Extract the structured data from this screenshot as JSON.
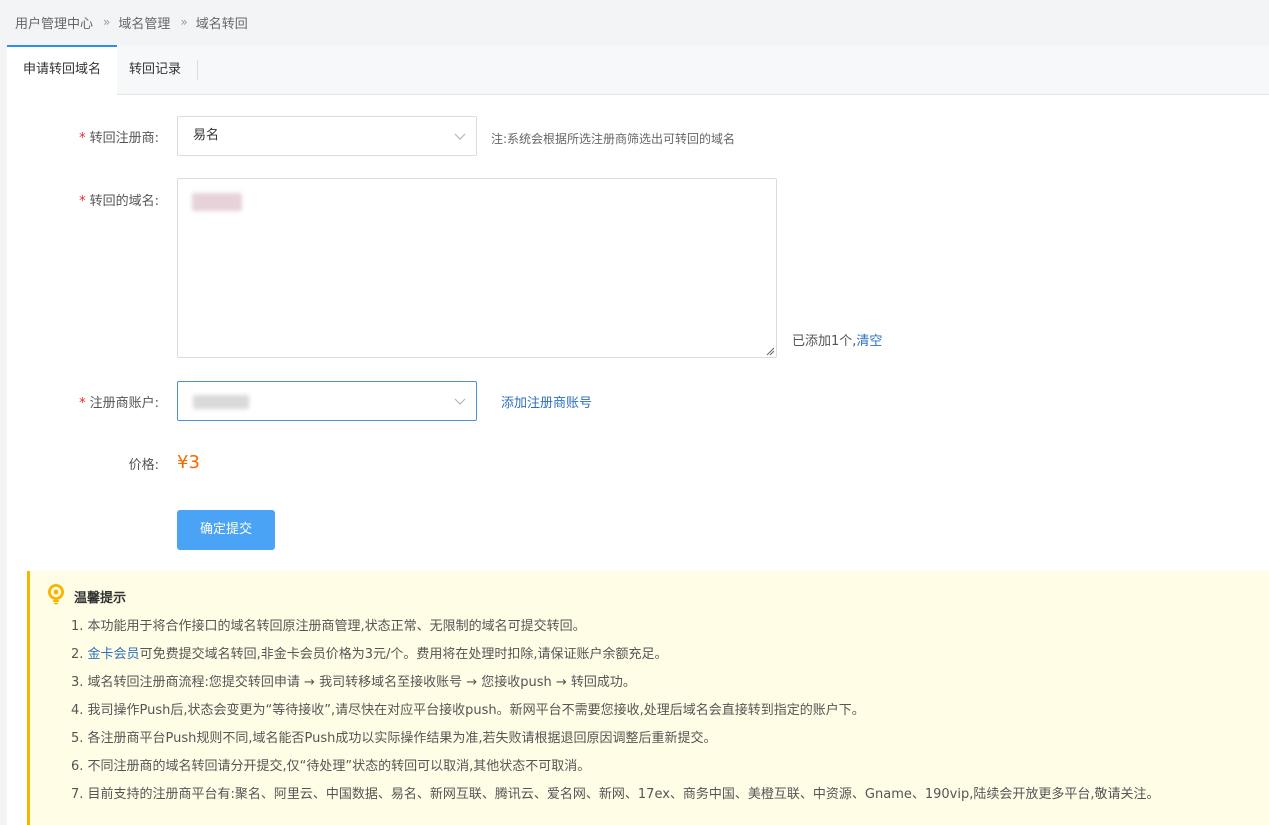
{
  "breadcrumb": [
    "用户管理中心",
    "域名管理",
    "域名转回"
  ],
  "breadcrumb_separator": "»",
  "tabs": [
    {
      "label": "申请转回域名",
      "active": true
    },
    {
      "label": "转回记录",
      "active": false
    }
  ],
  "form": {
    "registrar": {
      "required_mark": "*",
      "label": "转回注册商:",
      "value": "易名",
      "note": "注:系统会根据所选注册商筛选出可转回的域名"
    },
    "domain": {
      "required_mark": "*",
      "label": "转回的域名:",
      "added_text": "已添加1个,",
      "clear_link": "清空"
    },
    "account": {
      "required_mark": "*",
      "label": "注册商账户:",
      "add_link": "添加注册商账号"
    },
    "price": {
      "label": "价格:",
      "value": "¥3"
    },
    "submit_label": "确定提交"
  },
  "tips": {
    "title": "温馨提示",
    "items": [
      {
        "prefix": "1. 本功能用于将合作接口的域名转回原注册商管理,状态正常、无限制的域名可提交转回。",
        "link": "",
        "suffix": ""
      },
      {
        "prefix": "2. ",
        "link": "金卡会员",
        "suffix": "可免费提交域名转回,非金卡会员价格为3元/个。费用将在处理时扣除,请保证账户余额充足。"
      },
      {
        "prefix": "3. 域名转回注册商流程:您提交转回申请 → 我司转移域名至接收账号 → 您接收push → 转回成功。",
        "link": "",
        "suffix": ""
      },
      {
        "prefix": "4. 我司操作Push后,状态会变更为“等待接收”,请尽快在对应平台接收push。新网平台不需要您接收,处理后域名会直接转到指定的账户下。",
        "link": "",
        "suffix": ""
      },
      {
        "prefix": "5. 各注册商平台Push规则不同,域名能否Push成功以实际操作结果为准,若失败请根据退回原因调整后重新提交。",
        "link": "",
        "suffix": ""
      },
      {
        "prefix": "6. 不同注册商的域名转回请分开提交,仅“待处理”状态的转回可以取消,其他状态不可取消。",
        "link": "",
        "suffix": ""
      },
      {
        "prefix": "7. 目前支持的注册商平台有:聚名、阿里云、中国数据、易名、新网互联、腾讯云、爱名网、新网、17ex、商务中国、美橙互联、中资源、Gname、190vip,陆续会开放更多平台,敬请关注。",
        "link": "",
        "suffix": ""
      }
    ]
  },
  "colors": {
    "accent": "#2e8ded",
    "primary_button": "#4ba3f5",
    "price": "#f56a00",
    "tips_bg": "#fffde6",
    "tips_border": "#f7b500",
    "link": "#2e6fc1",
    "required": "#f5222d"
  },
  "icons": {
    "select_arrow": "chevron-down-icon",
    "tips": "lightbulb-icon"
  }
}
